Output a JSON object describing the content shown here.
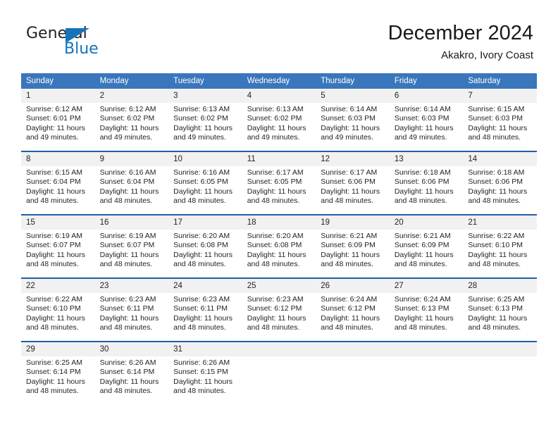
{
  "logo": {
    "primary_text": "General",
    "secondary_text": "Blue",
    "primary_color": "#231f20",
    "accent_color": "#1574bb"
  },
  "header": {
    "title": "December 2024",
    "subtitle": "Akakro, Ivory Coast"
  },
  "theme": {
    "header_blue": "#3a76bc",
    "row_divider_blue": "#1f5fa8",
    "daynum_band": "#f1f1f1",
    "text": "#231f20"
  },
  "weekday_headers": [
    "Sunday",
    "Monday",
    "Tuesday",
    "Wednesday",
    "Thursday",
    "Friday",
    "Saturday"
  ],
  "weeks": [
    {
      "days": [
        {
          "date": "1",
          "sunrise": "Sunrise: 6:12 AM",
          "sunset": "Sunset: 6:01 PM",
          "daylight_line1": "Daylight: 11 hours",
          "daylight_line2": "and 49 minutes."
        },
        {
          "date": "2",
          "sunrise": "Sunrise: 6:12 AM",
          "sunset": "Sunset: 6:02 PM",
          "daylight_line1": "Daylight: 11 hours",
          "daylight_line2": "and 49 minutes."
        },
        {
          "date": "3",
          "sunrise": "Sunrise: 6:13 AM",
          "sunset": "Sunset: 6:02 PM",
          "daylight_line1": "Daylight: 11 hours",
          "daylight_line2": "and 49 minutes."
        },
        {
          "date": "4",
          "sunrise": "Sunrise: 6:13 AM",
          "sunset": "Sunset: 6:02 PM",
          "daylight_line1": "Daylight: 11 hours",
          "daylight_line2": "and 49 minutes."
        },
        {
          "date": "5",
          "sunrise": "Sunrise: 6:14 AM",
          "sunset": "Sunset: 6:03 PM",
          "daylight_line1": "Daylight: 11 hours",
          "daylight_line2": "and 49 minutes."
        },
        {
          "date": "6",
          "sunrise": "Sunrise: 6:14 AM",
          "sunset": "Sunset: 6:03 PM",
          "daylight_line1": "Daylight: 11 hours",
          "daylight_line2": "and 49 minutes."
        },
        {
          "date": "7",
          "sunrise": "Sunrise: 6:15 AM",
          "sunset": "Sunset: 6:03 PM",
          "daylight_line1": "Daylight: 11 hours",
          "daylight_line2": "and 48 minutes."
        }
      ]
    },
    {
      "days": [
        {
          "date": "8",
          "sunrise": "Sunrise: 6:15 AM",
          "sunset": "Sunset: 6:04 PM",
          "daylight_line1": "Daylight: 11 hours",
          "daylight_line2": "and 48 minutes."
        },
        {
          "date": "9",
          "sunrise": "Sunrise: 6:16 AM",
          "sunset": "Sunset: 6:04 PM",
          "daylight_line1": "Daylight: 11 hours",
          "daylight_line2": "and 48 minutes."
        },
        {
          "date": "10",
          "sunrise": "Sunrise: 6:16 AM",
          "sunset": "Sunset: 6:05 PM",
          "daylight_line1": "Daylight: 11 hours",
          "daylight_line2": "and 48 minutes."
        },
        {
          "date": "11",
          "sunrise": "Sunrise: 6:17 AM",
          "sunset": "Sunset: 6:05 PM",
          "daylight_line1": "Daylight: 11 hours",
          "daylight_line2": "and 48 minutes."
        },
        {
          "date": "12",
          "sunrise": "Sunrise: 6:17 AM",
          "sunset": "Sunset: 6:06 PM",
          "daylight_line1": "Daylight: 11 hours",
          "daylight_line2": "and 48 minutes."
        },
        {
          "date": "13",
          "sunrise": "Sunrise: 6:18 AM",
          "sunset": "Sunset: 6:06 PM",
          "daylight_line1": "Daylight: 11 hours",
          "daylight_line2": "and 48 minutes."
        },
        {
          "date": "14",
          "sunrise": "Sunrise: 6:18 AM",
          "sunset": "Sunset: 6:06 PM",
          "daylight_line1": "Daylight: 11 hours",
          "daylight_line2": "and 48 minutes."
        }
      ]
    },
    {
      "days": [
        {
          "date": "15",
          "sunrise": "Sunrise: 6:19 AM",
          "sunset": "Sunset: 6:07 PM",
          "daylight_line1": "Daylight: 11 hours",
          "daylight_line2": "and 48 minutes."
        },
        {
          "date": "16",
          "sunrise": "Sunrise: 6:19 AM",
          "sunset": "Sunset: 6:07 PM",
          "daylight_line1": "Daylight: 11 hours",
          "daylight_line2": "and 48 minutes."
        },
        {
          "date": "17",
          "sunrise": "Sunrise: 6:20 AM",
          "sunset": "Sunset: 6:08 PM",
          "daylight_line1": "Daylight: 11 hours",
          "daylight_line2": "and 48 minutes."
        },
        {
          "date": "18",
          "sunrise": "Sunrise: 6:20 AM",
          "sunset": "Sunset: 6:08 PM",
          "daylight_line1": "Daylight: 11 hours",
          "daylight_line2": "and 48 minutes."
        },
        {
          "date": "19",
          "sunrise": "Sunrise: 6:21 AM",
          "sunset": "Sunset: 6:09 PM",
          "daylight_line1": "Daylight: 11 hours",
          "daylight_line2": "and 48 minutes."
        },
        {
          "date": "20",
          "sunrise": "Sunrise: 6:21 AM",
          "sunset": "Sunset: 6:09 PM",
          "daylight_line1": "Daylight: 11 hours",
          "daylight_line2": "and 48 minutes."
        },
        {
          "date": "21",
          "sunrise": "Sunrise: 6:22 AM",
          "sunset": "Sunset: 6:10 PM",
          "daylight_line1": "Daylight: 11 hours",
          "daylight_line2": "and 48 minutes."
        }
      ]
    },
    {
      "days": [
        {
          "date": "22",
          "sunrise": "Sunrise: 6:22 AM",
          "sunset": "Sunset: 6:10 PM",
          "daylight_line1": "Daylight: 11 hours",
          "daylight_line2": "and 48 minutes."
        },
        {
          "date": "23",
          "sunrise": "Sunrise: 6:23 AM",
          "sunset": "Sunset: 6:11 PM",
          "daylight_line1": "Daylight: 11 hours",
          "daylight_line2": "and 48 minutes."
        },
        {
          "date": "24",
          "sunrise": "Sunrise: 6:23 AM",
          "sunset": "Sunset: 6:11 PM",
          "daylight_line1": "Daylight: 11 hours",
          "daylight_line2": "and 48 minutes."
        },
        {
          "date": "25",
          "sunrise": "Sunrise: 6:23 AM",
          "sunset": "Sunset: 6:12 PM",
          "daylight_line1": "Daylight: 11 hours",
          "daylight_line2": "and 48 minutes."
        },
        {
          "date": "26",
          "sunrise": "Sunrise: 6:24 AM",
          "sunset": "Sunset: 6:12 PM",
          "daylight_line1": "Daylight: 11 hours",
          "daylight_line2": "and 48 minutes."
        },
        {
          "date": "27",
          "sunrise": "Sunrise: 6:24 AM",
          "sunset": "Sunset: 6:13 PM",
          "daylight_line1": "Daylight: 11 hours",
          "daylight_line2": "and 48 minutes."
        },
        {
          "date": "28",
          "sunrise": "Sunrise: 6:25 AM",
          "sunset": "Sunset: 6:13 PM",
          "daylight_line1": "Daylight: 11 hours",
          "daylight_line2": "and 48 minutes."
        }
      ]
    },
    {
      "days": [
        {
          "date": "29",
          "sunrise": "Sunrise: 6:25 AM",
          "sunset": "Sunset: 6:14 PM",
          "daylight_line1": "Daylight: 11 hours",
          "daylight_line2": "and 48 minutes."
        },
        {
          "date": "30",
          "sunrise": "Sunrise: 6:26 AM",
          "sunset": "Sunset: 6:14 PM",
          "daylight_line1": "Daylight: 11 hours",
          "daylight_line2": "and 48 minutes."
        },
        {
          "date": "31",
          "sunrise": "Sunrise: 6:26 AM",
          "sunset": "Sunset: 6:15 PM",
          "daylight_line1": "Daylight: 11 hours",
          "daylight_line2": "and 48 minutes."
        },
        {
          "date": "",
          "sunrise": "",
          "sunset": "",
          "daylight_line1": "",
          "daylight_line2": ""
        },
        {
          "date": "",
          "sunrise": "",
          "sunset": "",
          "daylight_line1": "",
          "daylight_line2": ""
        },
        {
          "date": "",
          "sunrise": "",
          "sunset": "",
          "daylight_line1": "",
          "daylight_line2": ""
        },
        {
          "date": "",
          "sunrise": "",
          "sunset": "",
          "daylight_line1": "",
          "daylight_line2": ""
        }
      ]
    }
  ]
}
